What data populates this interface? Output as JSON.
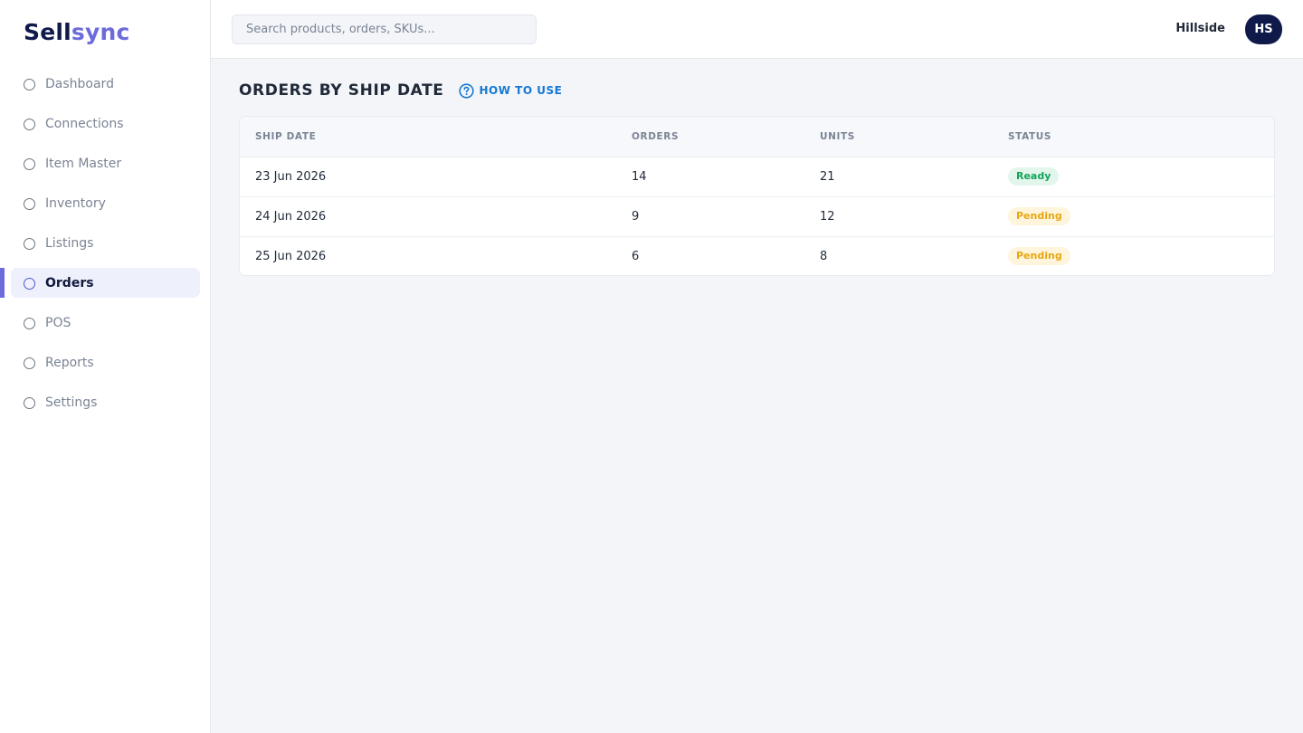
{
  "app": {
    "logo_part1": "Sell",
    "logo_part2": "sync"
  },
  "sidebar": {
    "items": [
      {
        "label": "Dashboard",
        "key": "dashboard",
        "active": false
      },
      {
        "label": "Connections",
        "key": "connections",
        "active": false
      },
      {
        "label": "Item Master",
        "key": "item-master",
        "active": false
      },
      {
        "label": "Inventory",
        "key": "inventory",
        "active": false
      },
      {
        "label": "Listings",
        "key": "listings",
        "active": false
      },
      {
        "label": "Orders",
        "key": "orders",
        "active": true
      },
      {
        "label": "POS",
        "key": "pos",
        "active": false
      },
      {
        "label": "Reports",
        "key": "reports",
        "active": false
      },
      {
        "label": "Settings",
        "key": "settings",
        "active": false
      }
    ]
  },
  "header": {
    "search_placeholder": "Search products, orders, SKUs...",
    "store_name": "Hillside",
    "avatar_initials": "HS"
  },
  "main": {
    "title": "ORDERS BY SHIP DATE",
    "help_label": "HOW TO USE",
    "table": {
      "columns": [
        "SHIP DATE",
        "ORDERS",
        "UNITS",
        "STATUS"
      ],
      "rows": [
        {
          "ship_date": "23 Jun 2026",
          "orders": "14",
          "units": "21",
          "status": "Ready",
          "status_kind": "ready"
        },
        {
          "ship_date": "24 Jun 2026",
          "orders": "9",
          "units": "12",
          "status": "Pending",
          "status_kind": "pending"
        },
        {
          "ship_date": "25 Jun 2026",
          "orders": "6",
          "units": "8",
          "status": "Pending",
          "status_kind": "pending"
        }
      ]
    }
  },
  "colors": {
    "brand_dark": "#0f1a4a",
    "brand_accent": "#6c6bdc",
    "link": "#1778d2",
    "ready": "#13a35a",
    "pending": "#e8a712"
  }
}
